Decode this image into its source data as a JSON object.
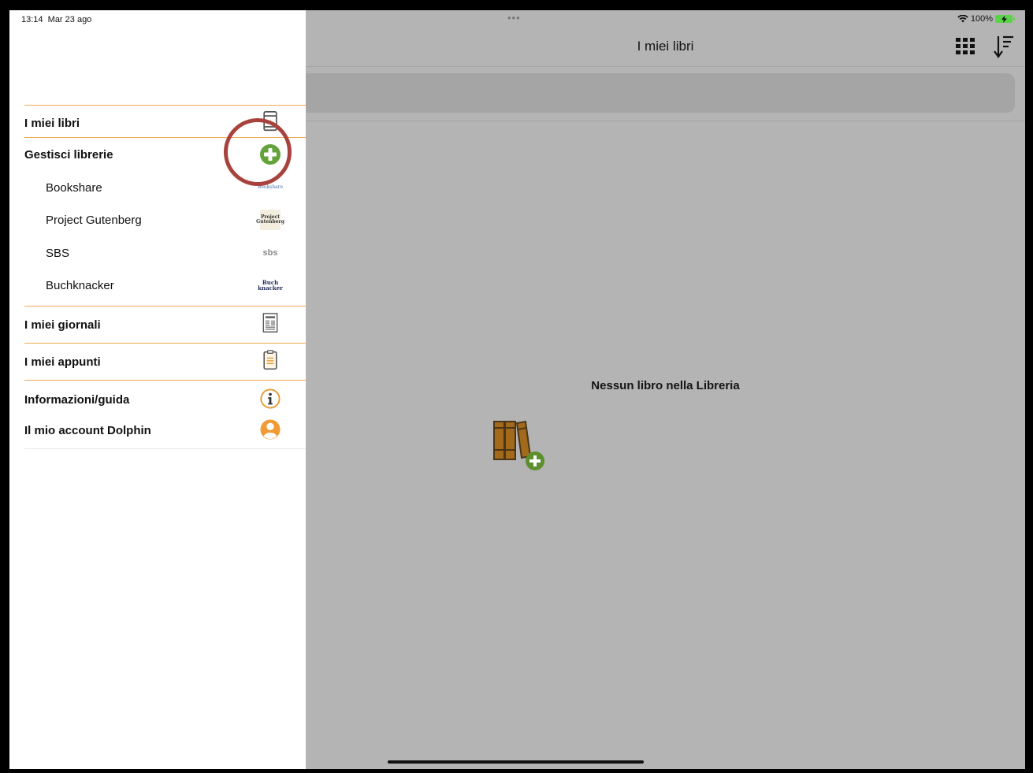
{
  "status": {
    "time": "13:14",
    "date": "Mar 23 ago",
    "dots": "•••",
    "battery": "100%"
  },
  "nav": {
    "title": "I miei libri",
    "grid_icon": "grid-icon",
    "sort_icon": "sort-icon"
  },
  "sidebar": {
    "items": [
      {
        "label": "I miei libri",
        "icon": "book-icon"
      },
      {
        "label": "Gestisci librerie",
        "icon": "add-icon"
      },
      {
        "label": "Bookshare",
        "icon": "bookshare-logo-icon"
      },
      {
        "label": "Project Gutenberg",
        "icon": "gutenberg-logo-icon"
      },
      {
        "label": "SBS",
        "icon": "sbs-logo-icon"
      },
      {
        "label": "Buchknacker",
        "icon": "buchknacker-logo-icon"
      },
      {
        "label": "I miei giornali",
        "icon": "newspaper-icon"
      },
      {
        "label": "I miei appunti",
        "icon": "clipboard-icon"
      },
      {
        "label": "Informazioni/guida",
        "icon": "info-icon"
      },
      {
        "label": "Il mio account Dolphin",
        "icon": "account-icon"
      }
    ],
    "logos": {
      "bookshare": "Bookshare",
      "gutenberg_1": "Project",
      "gutenberg_2": "Gutenberg",
      "sbs": "sbs",
      "buch_1": "Buch",
      "buch_2": "knacker"
    }
  },
  "main": {
    "empty_message": "Nessun libro nella Libreria"
  },
  "colors": {
    "accent_green": "#64a33a",
    "accent_orange": "#f0a955",
    "highlight_red": "#a8423c",
    "book_brown": "#a46a1c"
  }
}
